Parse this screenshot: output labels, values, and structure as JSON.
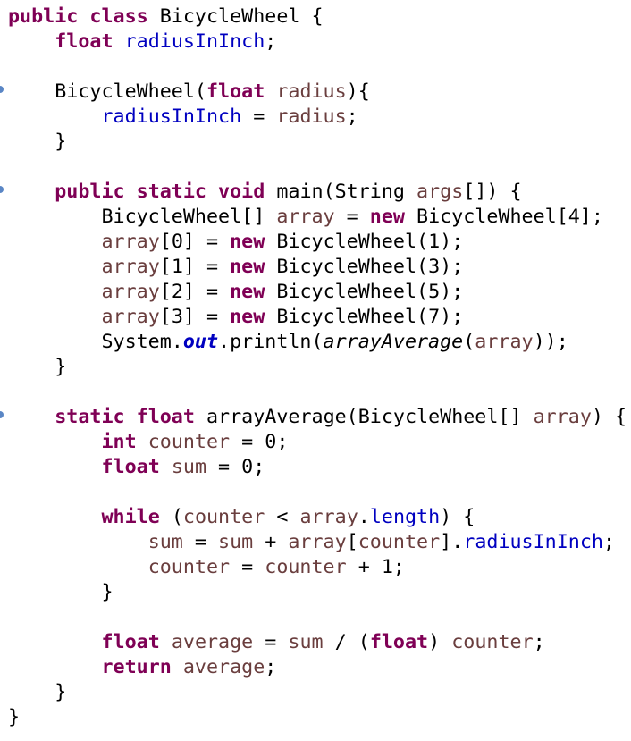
{
  "editor": {
    "language": "java",
    "lines": [
      [
        [
          "kw",
          "public"
        ],
        [
          "t",
          " "
        ],
        [
          "kw",
          "class"
        ],
        [
          "t",
          " BicycleWheel {"
        ]
      ],
      [
        [
          "t",
          "    "
        ],
        [
          "kw",
          "float"
        ],
        [
          "t",
          " "
        ],
        [
          "fld",
          "radiusInInch"
        ],
        [
          "t",
          ";"
        ]
      ],
      [
        [
          "t",
          ""
        ]
      ],
      [
        [
          "t",
          "    BicycleWheel("
        ],
        [
          "kw",
          "float"
        ],
        [
          "t",
          " "
        ],
        [
          "var",
          "radius"
        ],
        [
          "t",
          "){"
        ]
      ],
      [
        [
          "t",
          "        "
        ],
        [
          "fld",
          "radiusInInch"
        ],
        [
          "t",
          " = "
        ],
        [
          "var",
          "radius"
        ],
        [
          "t",
          ";"
        ]
      ],
      [
        [
          "t",
          "    }"
        ]
      ],
      [
        [
          "t",
          ""
        ]
      ],
      [
        [
          "t",
          "    "
        ],
        [
          "kw",
          "public"
        ],
        [
          "t",
          " "
        ],
        [
          "kw",
          "static"
        ],
        [
          "t",
          " "
        ],
        [
          "kw",
          "void"
        ],
        [
          "t",
          " main(String "
        ],
        [
          "var",
          "args"
        ],
        [
          "t",
          "[]) {"
        ]
      ],
      [
        [
          "t",
          "        BicycleWheel[] "
        ],
        [
          "var",
          "array"
        ],
        [
          "t",
          " = "
        ],
        [
          "kw",
          "new"
        ],
        [
          "t",
          " BicycleWheel[4];"
        ]
      ],
      [
        [
          "t",
          "        "
        ],
        [
          "var",
          "array"
        ],
        [
          "t",
          "[0] = "
        ],
        [
          "kw",
          "new"
        ],
        [
          "t",
          " BicycleWheel(1);"
        ]
      ],
      [
        [
          "t",
          "        "
        ],
        [
          "var",
          "array"
        ],
        [
          "t",
          "[1] = "
        ],
        [
          "kw",
          "new"
        ],
        [
          "t",
          " BicycleWheel(3);"
        ]
      ],
      [
        [
          "t",
          "        "
        ],
        [
          "var",
          "array"
        ],
        [
          "t",
          "[2] = "
        ],
        [
          "kw",
          "new"
        ],
        [
          "t",
          " BicycleWheel(5);"
        ]
      ],
      [
        [
          "t",
          "        "
        ],
        [
          "var",
          "array"
        ],
        [
          "t",
          "[3] = "
        ],
        [
          "kw",
          "new"
        ],
        [
          "t",
          " BicycleWheel(7);"
        ]
      ],
      [
        [
          "t",
          "        System."
        ],
        [
          "stat",
          "out"
        ],
        [
          "t",
          ".println("
        ],
        [
          "call",
          "arrayAverage"
        ],
        [
          "t",
          "("
        ],
        [
          "var",
          "array"
        ],
        [
          "t",
          "));"
        ]
      ],
      [
        [
          "t",
          "    }"
        ]
      ],
      [
        [
          "t",
          ""
        ]
      ],
      [
        [
          "t",
          "    "
        ],
        [
          "kw",
          "static"
        ],
        [
          "t",
          " "
        ],
        [
          "kw",
          "float"
        ],
        [
          "t",
          " arrayAverage(BicycleWheel[] "
        ],
        [
          "var",
          "array"
        ],
        [
          "t",
          ") {"
        ]
      ],
      [
        [
          "t",
          "        "
        ],
        [
          "kw",
          "int"
        ],
        [
          "t",
          " "
        ],
        [
          "var",
          "counter"
        ],
        [
          "t",
          " = 0;"
        ]
      ],
      [
        [
          "t",
          "        "
        ],
        [
          "kw",
          "float"
        ],
        [
          "t",
          " "
        ],
        [
          "var",
          "sum"
        ],
        [
          "t",
          " = 0;"
        ]
      ],
      [
        [
          "t",
          ""
        ]
      ],
      [
        [
          "t",
          "        "
        ],
        [
          "kw",
          "while"
        ],
        [
          "t",
          " ("
        ],
        [
          "var",
          "counter"
        ],
        [
          "t",
          " < "
        ],
        [
          "var",
          "array"
        ],
        [
          "t",
          "."
        ],
        [
          "fld",
          "length"
        ],
        [
          "t",
          ") {"
        ]
      ],
      [
        [
          "t",
          "            "
        ],
        [
          "var",
          "sum"
        ],
        [
          "t",
          " = "
        ],
        [
          "var",
          "sum"
        ],
        [
          "t",
          " + "
        ],
        [
          "var",
          "array"
        ],
        [
          "t",
          "["
        ],
        [
          "var",
          "counter"
        ],
        [
          "t",
          "]."
        ],
        [
          "fld",
          "radiusInInch"
        ],
        [
          "t",
          ";"
        ]
      ],
      [
        [
          "t",
          "            "
        ],
        [
          "var",
          "counter"
        ],
        [
          "t",
          " = "
        ],
        [
          "var",
          "counter"
        ],
        [
          "t",
          " + 1;"
        ]
      ],
      [
        [
          "t",
          "        }"
        ]
      ],
      [
        [
          "t",
          ""
        ]
      ],
      [
        [
          "t",
          "        "
        ],
        [
          "kw",
          "float"
        ],
        [
          "t",
          " "
        ],
        [
          "var",
          "average"
        ],
        [
          "t",
          " = "
        ],
        [
          "var",
          "sum"
        ],
        [
          "t",
          " / ("
        ],
        [
          "kw",
          "float"
        ],
        [
          "t",
          ") "
        ],
        [
          "var",
          "counter"
        ],
        [
          "t",
          ";"
        ]
      ],
      [
        [
          "t",
          "        "
        ],
        [
          "kw",
          "return"
        ],
        [
          "t",
          " "
        ],
        [
          "var",
          "average"
        ],
        [
          "t",
          ";"
        ]
      ],
      [
        [
          "t",
          "    }"
        ]
      ],
      [
        [
          "t",
          "}"
        ]
      ]
    ],
    "colors": {
      "keyword": "#7f0055",
      "field": "#0000c0",
      "local_variable": "#6a3e3e",
      "default_text": "#000000",
      "gutter_marker": "#5a86c5"
    }
  }
}
